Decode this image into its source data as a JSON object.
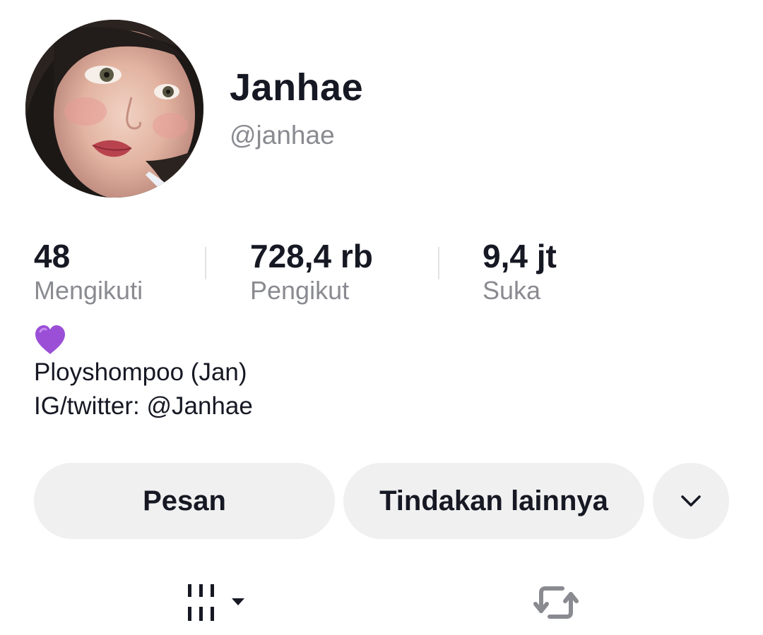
{
  "profile": {
    "display_name": "Janhae",
    "username": "@janhae",
    "avatar": "profile-photo"
  },
  "stats": [
    {
      "value": "48",
      "label": "Mengikuti"
    },
    {
      "value": "728,4 rb",
      "label": "Pengikut"
    },
    {
      "value": "9,4 jt",
      "label": "Suka"
    }
  ],
  "bio": {
    "emoji": "purple-heart",
    "lines": [
      "Ployshompoo (Jan)",
      "IG/twitter: @Janhae"
    ]
  },
  "actions": {
    "message_label": "Pesan",
    "more_actions_label": "Tindakan lainnya",
    "dropdown_icon": "chevron-down-icon"
  },
  "tabs": [
    {
      "icon": "grid-videos-icon",
      "has_dropdown": true
    },
    {
      "icon": "repost-icon"
    }
  ],
  "colors": {
    "text_primary": "#161823",
    "text_secondary": "#8a8b91",
    "button_bg": "#f0f0f1",
    "heart": "#9b4fd6"
  }
}
